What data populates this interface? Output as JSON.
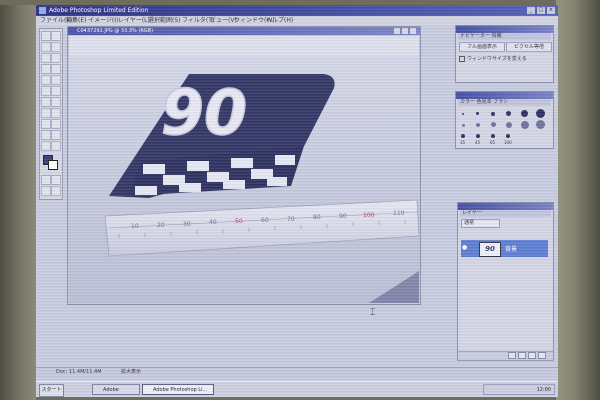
{
  "window": {
    "title": "Adobe Photoshop Limited Edition"
  },
  "menu": {
    "items": [
      "ファイル(F)",
      "編集(E)",
      "イメージ(I)",
      "レイヤー(L)",
      "選択範囲(S)",
      "フィルタ(T)",
      "ビュー(V)",
      "ウィンドウ(W)",
      "ヘルプ(H)"
    ]
  },
  "document": {
    "title": "C0437292.JPG @ 33.3% (RGB)",
    "sign_text": "90"
  },
  "navigator": {
    "tabs": "ナビゲーター  情報",
    "button_left": "フル画面表示",
    "button_right": "ピクセル等倍",
    "option": "ウィンドウサイズを変える"
  },
  "color_panel": {
    "tabs": "カラー  色見本  ブラシ",
    "brush_sizes": [
      "35",
      "45",
      "65",
      "100"
    ]
  },
  "layers": {
    "header": "レイヤー",
    "mode": "通常",
    "layer_name": "背景",
    "thumb_text": "90"
  },
  "statusbar": {
    "doc_info": "Doc: 11.4M/11.4M",
    "zoom_hint": "拡大表示"
  },
  "taskbar": {
    "start": "スタート",
    "tasks": [
      "Adobe Illustrator",
      "Adobe Photoshop Li..."
    ],
    "clock": "12:00"
  },
  "chart_data": null
}
